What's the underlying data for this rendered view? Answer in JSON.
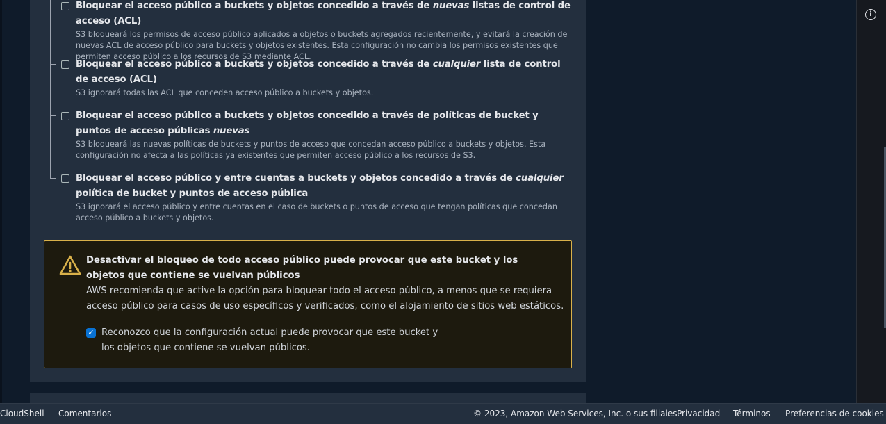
{
  "options": [
    {
      "title_pre": "Bloquear el acceso público a buckets y objetos concedido a través de ",
      "title_em": "nuevas",
      "title_post": " listas de control de acceso (ACL)",
      "description": "S3 bloqueará los permisos de acceso público aplicados a objetos o buckets agregados recientemente, y evitará la creación de nuevas ACL de acceso público para buckets y objetos existentes. Esta configuración no cambia los permisos existentes que permiten acceso público a los recursos de S3 mediante ACL.",
      "checked": false
    },
    {
      "title_pre": "Bloquear el acceso público a buckets y objetos concedido a través de ",
      "title_em": "cualquier",
      "title_post": " lista de control de acceso (ACL)",
      "description": "S3 ignorará todas las ACL que conceden acceso público a buckets y objetos.",
      "checked": false
    },
    {
      "title_pre": "Bloquear el acceso público a buckets y objetos concedido a través de políticas de bucket y puntos de acceso públicas ",
      "title_em": "nuevas",
      "title_post": "",
      "description": "S3 bloqueará las nuevas políticas de buckets y puntos de acceso que concedan acceso público a buckets y objetos. Esta configuración no afecta a las políticas ya existentes que permiten acceso público a los recursos de S3.",
      "checked": false
    },
    {
      "title_pre": "Bloquear el acceso público y entre cuentas a buckets y objetos concedido a través de ",
      "title_em": "cualquier",
      "title_post": " política de bucket y puntos de acceso pública",
      "description": "S3 ignorará el acceso público y entre cuentas en el caso de buckets o puntos de acceso que tengan políticas que concedan acceso público a buckets y objetos.",
      "checked": false
    }
  ],
  "warning": {
    "title": "Desactivar el bloqueo de todo acceso público puede provocar que este bucket y los objetos que contiene se vuelvan públicos",
    "body": "AWS recomienda que active la opción para bloquear todo el acceso público, a menos que se requiera acceso público para casos de uso específicos y verificados, como el alojamiento de sitios web estáticos.",
    "acknowledge_label": "Reconozco que la configuración actual puede provocar que este bucket y los objetos que contiene se vuelvan públicos.",
    "acknowledge_checked": true,
    "check_glyph": "✓",
    "color": "#d9b14a"
  },
  "side": {
    "info_icon": "info-icon",
    "info_glyph": "i"
  },
  "footer": {
    "cloudshell": "CloudShell",
    "feedback": "Comentarios",
    "copyright": "© 2023, Amazon Web Services, Inc. o sus filiales.",
    "privacy": "Privacidad",
    "terms": "Términos",
    "cookies": "Preferencias de cookies"
  }
}
